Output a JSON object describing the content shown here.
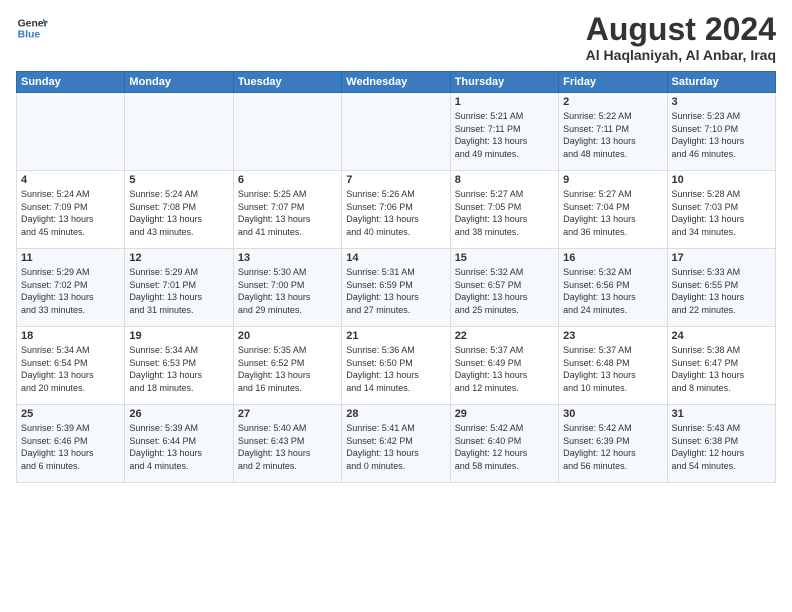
{
  "logo": {
    "general": "General",
    "blue": "Blue"
  },
  "header": {
    "month": "August 2024",
    "location": "Al Haqlaniyah, Al Anbar, Iraq"
  },
  "weekdays": [
    "Sunday",
    "Monday",
    "Tuesday",
    "Wednesday",
    "Thursday",
    "Friday",
    "Saturday"
  ],
  "weeks": [
    [
      {
        "day": "",
        "info": ""
      },
      {
        "day": "",
        "info": ""
      },
      {
        "day": "",
        "info": ""
      },
      {
        "day": "",
        "info": ""
      },
      {
        "day": "1",
        "info": "Sunrise: 5:21 AM\nSunset: 7:11 PM\nDaylight: 13 hours\nand 49 minutes."
      },
      {
        "day": "2",
        "info": "Sunrise: 5:22 AM\nSunset: 7:11 PM\nDaylight: 13 hours\nand 48 minutes."
      },
      {
        "day": "3",
        "info": "Sunrise: 5:23 AM\nSunset: 7:10 PM\nDaylight: 13 hours\nand 46 minutes."
      }
    ],
    [
      {
        "day": "4",
        "info": "Sunrise: 5:24 AM\nSunset: 7:09 PM\nDaylight: 13 hours\nand 45 minutes."
      },
      {
        "day": "5",
        "info": "Sunrise: 5:24 AM\nSunset: 7:08 PM\nDaylight: 13 hours\nand 43 minutes."
      },
      {
        "day": "6",
        "info": "Sunrise: 5:25 AM\nSunset: 7:07 PM\nDaylight: 13 hours\nand 41 minutes."
      },
      {
        "day": "7",
        "info": "Sunrise: 5:26 AM\nSunset: 7:06 PM\nDaylight: 13 hours\nand 40 minutes."
      },
      {
        "day": "8",
        "info": "Sunrise: 5:27 AM\nSunset: 7:05 PM\nDaylight: 13 hours\nand 38 minutes."
      },
      {
        "day": "9",
        "info": "Sunrise: 5:27 AM\nSunset: 7:04 PM\nDaylight: 13 hours\nand 36 minutes."
      },
      {
        "day": "10",
        "info": "Sunrise: 5:28 AM\nSunset: 7:03 PM\nDaylight: 13 hours\nand 34 minutes."
      }
    ],
    [
      {
        "day": "11",
        "info": "Sunrise: 5:29 AM\nSunset: 7:02 PM\nDaylight: 13 hours\nand 33 minutes."
      },
      {
        "day": "12",
        "info": "Sunrise: 5:29 AM\nSunset: 7:01 PM\nDaylight: 13 hours\nand 31 minutes."
      },
      {
        "day": "13",
        "info": "Sunrise: 5:30 AM\nSunset: 7:00 PM\nDaylight: 13 hours\nand 29 minutes."
      },
      {
        "day": "14",
        "info": "Sunrise: 5:31 AM\nSunset: 6:59 PM\nDaylight: 13 hours\nand 27 minutes."
      },
      {
        "day": "15",
        "info": "Sunrise: 5:32 AM\nSunset: 6:57 PM\nDaylight: 13 hours\nand 25 minutes."
      },
      {
        "day": "16",
        "info": "Sunrise: 5:32 AM\nSunset: 6:56 PM\nDaylight: 13 hours\nand 24 minutes."
      },
      {
        "day": "17",
        "info": "Sunrise: 5:33 AM\nSunset: 6:55 PM\nDaylight: 13 hours\nand 22 minutes."
      }
    ],
    [
      {
        "day": "18",
        "info": "Sunrise: 5:34 AM\nSunset: 6:54 PM\nDaylight: 13 hours\nand 20 minutes."
      },
      {
        "day": "19",
        "info": "Sunrise: 5:34 AM\nSunset: 6:53 PM\nDaylight: 13 hours\nand 18 minutes."
      },
      {
        "day": "20",
        "info": "Sunrise: 5:35 AM\nSunset: 6:52 PM\nDaylight: 13 hours\nand 16 minutes."
      },
      {
        "day": "21",
        "info": "Sunrise: 5:36 AM\nSunset: 6:50 PM\nDaylight: 13 hours\nand 14 minutes."
      },
      {
        "day": "22",
        "info": "Sunrise: 5:37 AM\nSunset: 6:49 PM\nDaylight: 13 hours\nand 12 minutes."
      },
      {
        "day": "23",
        "info": "Sunrise: 5:37 AM\nSunset: 6:48 PM\nDaylight: 13 hours\nand 10 minutes."
      },
      {
        "day": "24",
        "info": "Sunrise: 5:38 AM\nSunset: 6:47 PM\nDaylight: 13 hours\nand 8 minutes."
      }
    ],
    [
      {
        "day": "25",
        "info": "Sunrise: 5:39 AM\nSunset: 6:46 PM\nDaylight: 13 hours\nand 6 minutes."
      },
      {
        "day": "26",
        "info": "Sunrise: 5:39 AM\nSunset: 6:44 PM\nDaylight: 13 hours\nand 4 minutes."
      },
      {
        "day": "27",
        "info": "Sunrise: 5:40 AM\nSunset: 6:43 PM\nDaylight: 13 hours\nand 2 minutes."
      },
      {
        "day": "28",
        "info": "Sunrise: 5:41 AM\nSunset: 6:42 PM\nDaylight: 13 hours\nand 0 minutes."
      },
      {
        "day": "29",
        "info": "Sunrise: 5:42 AM\nSunset: 6:40 PM\nDaylight: 12 hours\nand 58 minutes."
      },
      {
        "day": "30",
        "info": "Sunrise: 5:42 AM\nSunset: 6:39 PM\nDaylight: 12 hours\nand 56 minutes."
      },
      {
        "day": "31",
        "info": "Sunrise: 5:43 AM\nSunset: 6:38 PM\nDaylight: 12 hours\nand 54 minutes."
      }
    ]
  ]
}
